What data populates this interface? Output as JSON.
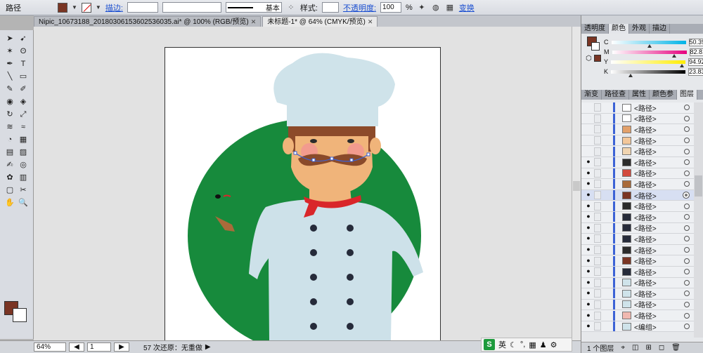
{
  "control_bar": {
    "object_type": "路径",
    "stroke_label": "描边:",
    "stroke_profile": "基本",
    "style_label": "样式:",
    "opacity_label": "不透明度:",
    "opacity_value": "100",
    "opacity_unit": "%",
    "transform_label": "变换",
    "fill_color": "#7a3524"
  },
  "doc_tabs": [
    {
      "label": "Nipic_10673188_20180306153602536035.ai* @ 100% (RGB/预览)"
    },
    {
      "label": "未标题-1* @ 64% (CMYK/预览)"
    }
  ],
  "tools": {
    "icons": [
      "selection-icon",
      "direct-selection-icon",
      "magic-wand-icon",
      "lasso-icon",
      "pen-icon",
      "type-icon",
      "line-icon",
      "rectangle-icon",
      "paintbrush-icon",
      "pencil-icon",
      "blob-brush-icon",
      "eraser-icon",
      "rotate-icon",
      "scale-icon",
      "width-icon",
      "warp-icon",
      "shape-builder-icon",
      "perspective-icon",
      "mesh-icon",
      "gradient-icon",
      "eyedropper-icon",
      "blend-icon",
      "symbol-sprayer-icon",
      "graph-icon",
      "artboard-icon",
      "slice-icon",
      "hand-icon",
      "zoom-icon"
    ]
  },
  "status": {
    "zoom": "64%",
    "artboard": "1",
    "message": "57 次还原：无重做"
  },
  "ime": {
    "label": "英"
  },
  "color_panel": {
    "tabs": [
      "透明度",
      "颜色",
      "外观",
      "描边"
    ],
    "active_tab": "颜色",
    "channels": [
      {
        "name": "C",
        "value": "50.39",
        "gradient": [
          "#ffffff",
          "#00b3e6"
        ],
        "pos": 50.39
      },
      {
        "name": "M",
        "value": "82.81",
        "gradient": [
          "#ffffff",
          "#e6007e"
        ],
        "pos": 82.81
      },
      {
        "name": "Y",
        "value": "94.92",
        "gradient": [
          "#ffffff",
          "#ffed00"
        ],
        "pos": 94.92
      },
      {
        "name": "K",
        "value": "23.83",
        "gradient": [
          "#ffffff",
          "#000000"
        ],
        "pos": 23.83
      }
    ]
  },
  "layers_panel": {
    "tabs": [
      "渐变",
      "路径查",
      "属性",
      "颜色参",
      "图层"
    ],
    "active_tab": "图层",
    "rows": [
      {
        "name": "<路径>",
        "visible": false,
        "thumb": "#ffffff"
      },
      {
        "name": "<路径>",
        "visible": false,
        "thumb": "#ffffff"
      },
      {
        "name": "<路径>",
        "visible": false,
        "thumb": "#e2a06a"
      },
      {
        "name": "<路径>",
        "visible": false,
        "thumb": "#f3c79a"
      },
      {
        "name": "<路径>",
        "visible": false,
        "thumb": "#f0d4b0"
      },
      {
        "name": "<路径>",
        "visible": true,
        "thumb": "#2b2b2b"
      },
      {
        "name": "<路径>",
        "visible": true,
        "thumb": "#d24a3e"
      },
      {
        "name": "<路径>",
        "visible": true,
        "thumb": "#a96b3a"
      },
      {
        "name": "<路径>",
        "visible": true,
        "thumb": "#7a3524",
        "selected": true
      },
      {
        "name": "<路径>",
        "visible": true,
        "thumb": "#2b2b2b"
      },
      {
        "name": "<路径>",
        "visible": true,
        "thumb": "#262b3a"
      },
      {
        "name": "<路径>",
        "visible": true,
        "thumb": "#262b3a"
      },
      {
        "name": "<路径>",
        "visible": true,
        "thumb": "#262b3a"
      },
      {
        "name": "<路径>",
        "visible": true,
        "thumb": "#2b2b2b"
      },
      {
        "name": "<路径>",
        "visible": true,
        "thumb": "#7a3524"
      },
      {
        "name": "<路径>",
        "visible": true,
        "thumb": "#262b3a"
      },
      {
        "name": "<路径>",
        "visible": true,
        "thumb": "#cfe3ea"
      },
      {
        "name": "<路径>",
        "visible": true,
        "thumb": "#cfe3ea"
      },
      {
        "name": "<路径>",
        "visible": true,
        "thumb": "#cfe3ea"
      },
      {
        "name": "<路径>",
        "visible": true,
        "thumb": "#f0b8b0"
      },
      {
        "name": "<编组>",
        "visible": true,
        "thumb": "#cfe3ea"
      }
    ],
    "footer": "1 个图层"
  },
  "colors": {
    "chef_hat": "#cfe3ea",
    "background_circle": "#178a3c",
    "skin": "#f0b47a",
    "hair": "#8c4a2a",
    "mustache": "#8a4a2a",
    "neckerchief": "#d9262a",
    "coat": "#cde1e9",
    "buttons": "#262b3a",
    "cheeks": "#f29b8e"
  }
}
